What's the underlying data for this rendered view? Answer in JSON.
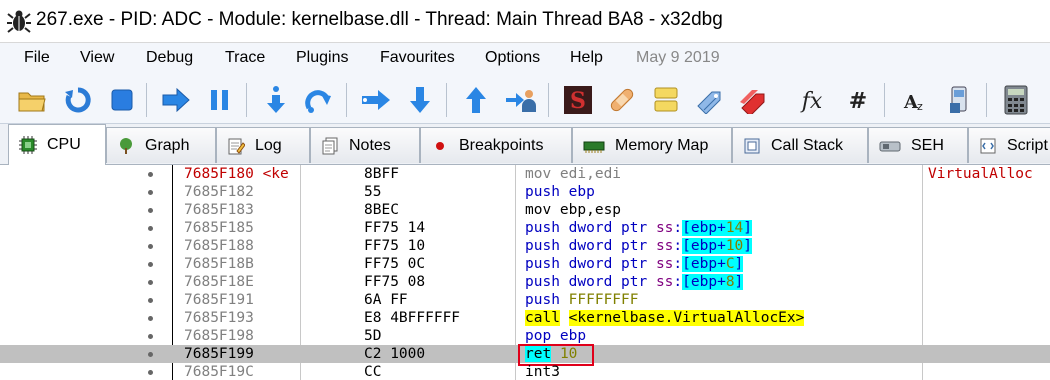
{
  "window": {
    "title": "267.exe - PID: ADC - Module: kernelbase.dll - Thread: Main Thread BA8 - x32dbg"
  },
  "menu": [
    {
      "label": "File"
    },
    {
      "label": "View"
    },
    {
      "label": "Debug"
    },
    {
      "label": "Trace"
    },
    {
      "label": "Plugins"
    },
    {
      "label": "Favourites"
    },
    {
      "label": "Options"
    },
    {
      "label": "Help"
    },
    {
      "label": "May 9 2019"
    }
  ],
  "toolbar": {
    "icons": [
      "open-icon",
      "restart-icon",
      "stop-icon",
      "run-icon",
      "pause-icon",
      "step-into-icon",
      "step-over-icon",
      "trace-into-icon",
      "trace-over-icon",
      "execute-till-return-icon",
      "run-to-user-code-icon",
      "scylla-icon",
      "patch-icon",
      "comments-icon",
      "labels-icon",
      "bookmarks-icon",
      "functions-icon",
      "variables-icon",
      "hash-icon",
      "case-icon",
      "calculator-icon"
    ]
  },
  "tabs": [
    {
      "label": "CPU",
      "active": true
    },
    {
      "label": "Graph"
    },
    {
      "label": "Log"
    },
    {
      "label": "Notes"
    },
    {
      "label": "Breakpoints"
    },
    {
      "label": "Memory Map"
    },
    {
      "label": "Call Stack"
    },
    {
      "label": "SEH"
    },
    {
      "label": "Script"
    }
  ],
  "disasm": {
    "rows": [
      {
        "addr": "7685F180 <ke",
        "bytes": "8BFF",
        "instr": "mov edi,edi",
        "comment": "VirtualAlloc"
      },
      {
        "addr": "7685F182",
        "bytes": "55",
        "instr": "push ebp"
      },
      {
        "addr": "7685F183",
        "bytes": "8BEC",
        "instr": "mov ebp,esp"
      },
      {
        "addr": "7685F185",
        "bytes": "FF75 14",
        "instr": "push dword ptr ss:[ebp+14]"
      },
      {
        "addr": "7685F188",
        "bytes": "FF75 10",
        "instr": "push dword ptr ss:[ebp+10]"
      },
      {
        "addr": "7685F18B",
        "bytes": "FF75 0C",
        "instr": "push dword ptr ss:[ebp+C]"
      },
      {
        "addr": "7685F18E",
        "bytes": "FF75 08",
        "instr": "push dword ptr ss:[ebp+8]"
      },
      {
        "addr": "7685F191",
        "bytes": "6A FF",
        "instr": "push FFFFFFFF"
      },
      {
        "addr": "7685F193",
        "bytes": "E8 4BFFFFFF",
        "instr": "call <kernelbase.VirtualAllocEx>"
      },
      {
        "addr": "7685F198",
        "bytes": "5D",
        "instr": "pop ebp"
      },
      {
        "addr": "7685F199",
        "bytes": "C2 1000",
        "instr": "ret 10"
      },
      {
        "addr": "7685F19C",
        "bytes": "CC",
        "instr": "int3"
      }
    ]
  }
}
